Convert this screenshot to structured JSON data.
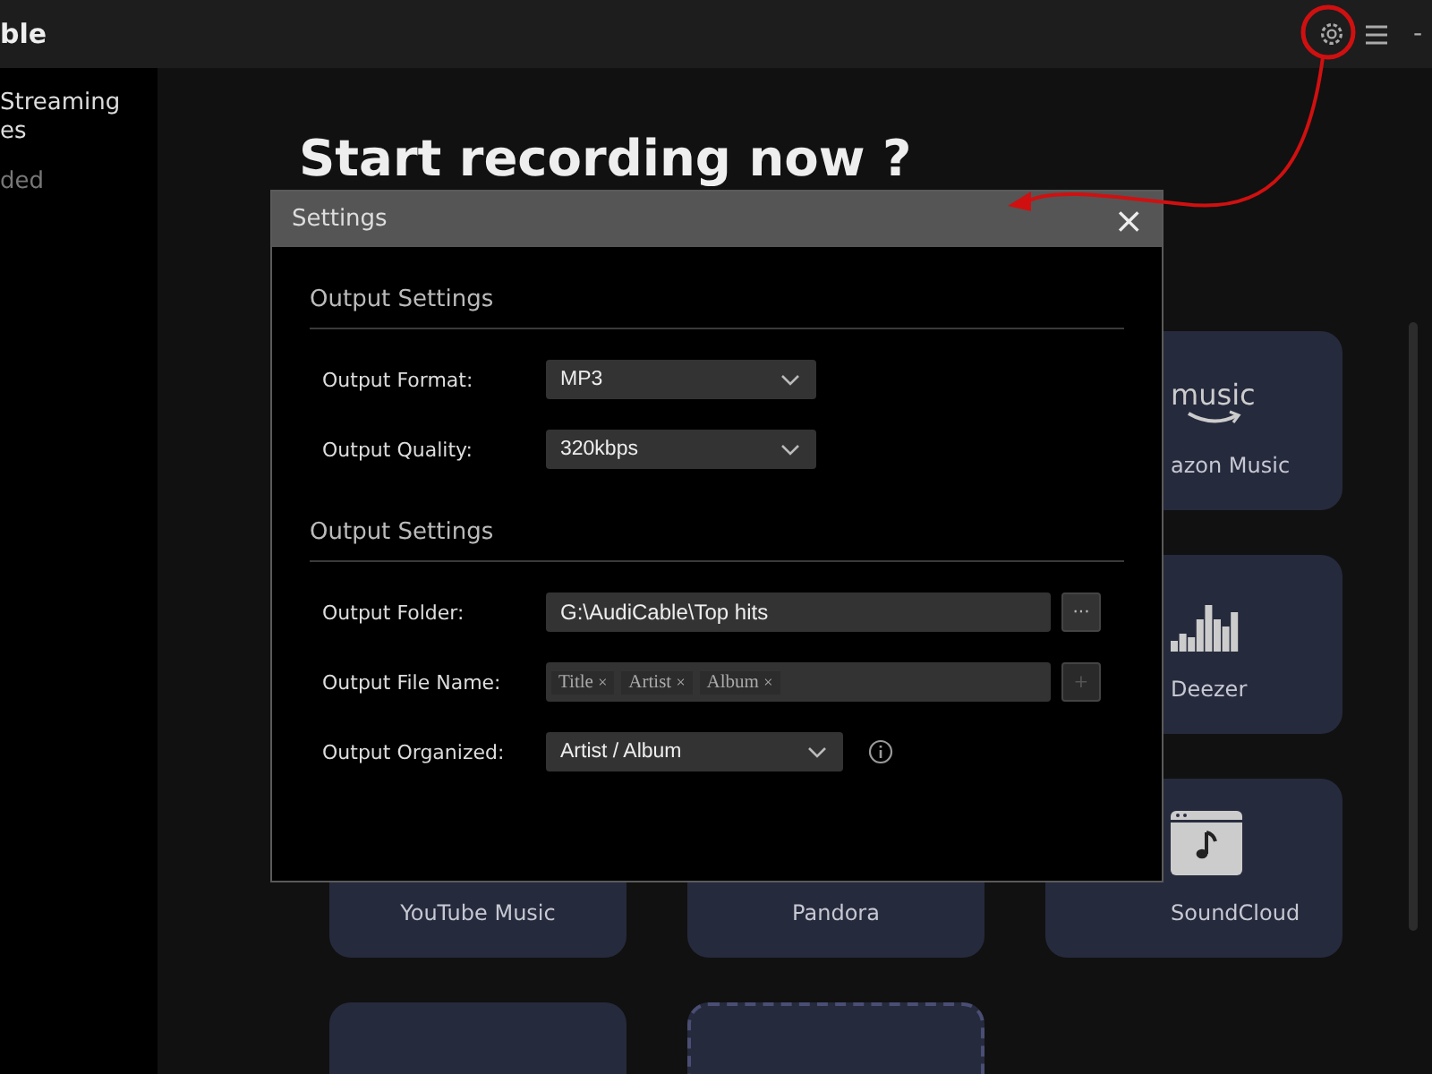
{
  "app": {
    "title": "ble"
  },
  "sidebar": {
    "items": [
      {
        "label": "Streaming\nes",
        "selected": true
      },
      {
        "label": "ded",
        "selected": false
      }
    ]
  },
  "window_controls": {
    "minimize": "-"
  },
  "main": {
    "heading": "Start recording now ?"
  },
  "card_rows": [
    [
      {
        "kind": "covered"
      },
      {
        "kind": "covered"
      },
      {
        "kind": "amazon",
        "logo": "music",
        "label": "azon Music"
      }
    ],
    [
      {
        "kind": "covered"
      },
      {
        "kind": "covered"
      },
      {
        "kind": "deezer",
        "label": "Deezer"
      }
    ],
    [
      {
        "kind": "plain",
        "label": "YouTube Music"
      },
      {
        "kind": "plain",
        "label": "Pandora"
      },
      {
        "kind": "soundcloud",
        "label": "SoundCloud"
      }
    ],
    [
      {
        "kind": "plain"
      },
      {
        "kind": "add"
      }
    ]
  ],
  "dialog": {
    "title": "Settings",
    "close": "×",
    "sections": [
      {
        "title": "Output Settings",
        "rows": [
          {
            "kind": "dropdown",
            "label": "Output Format:",
            "value": "MP3"
          },
          {
            "kind": "dropdown",
            "label": "Output Quality:",
            "value": "320kbps"
          }
        ]
      },
      {
        "title": "Output Settings",
        "rows": [
          {
            "kind": "folder",
            "label": "Output Folder:",
            "value": "G:\\AudiCable\\Top hits",
            "button": "···"
          },
          {
            "kind": "tags",
            "label": "Output File Name:",
            "tags": [
              {
                "label": "Title",
                "remove": "×"
              },
              {
                "label": "Artist",
                "remove": "×"
              },
              {
                "label": "Album",
                "remove": "×"
              }
            ],
            "button": "+",
            "disabled": true
          },
          {
            "kind": "dropdown_info",
            "label": "Output Organized:",
            "value": "Artist / Album"
          }
        ]
      }
    ]
  }
}
